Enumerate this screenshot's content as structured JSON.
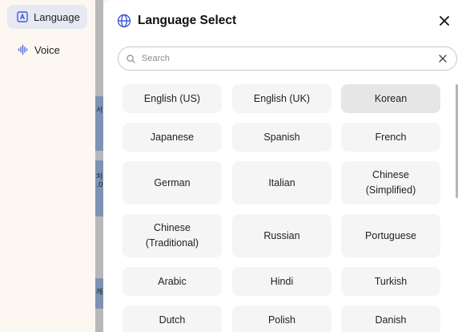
{
  "sidebar": {
    "items": [
      {
        "label": "Language",
        "icon": "language-icon"
      },
      {
        "label": "Voice",
        "icon": "voice-waveform-icon"
      }
    ]
  },
  "background_fragments": [
    "서",
    "처:",
    ".0",
    "캐-"
  ],
  "modal": {
    "title": "Language Select",
    "search_placeholder": "Search",
    "languages": [
      {
        "label": "English (US)",
        "selected": false
      },
      {
        "label": "English (UK)",
        "selected": false
      },
      {
        "label": "Korean",
        "selected": true
      },
      {
        "label": "Japanese",
        "selected": false
      },
      {
        "label": "Spanish",
        "selected": false
      },
      {
        "label": "French",
        "selected": false
      },
      {
        "label": "German",
        "selected": false
      },
      {
        "label": "Italian",
        "selected": false
      },
      {
        "label": "Chinese\n(Simplified)",
        "selected": false
      },
      {
        "label": "Chinese\n(Traditional)",
        "selected": false
      },
      {
        "label": "Russian",
        "selected": false
      },
      {
        "label": "Portuguese",
        "selected": false
      },
      {
        "label": "Arabic",
        "selected": false
      },
      {
        "label": "Hindi",
        "selected": false
      },
      {
        "label": "Turkish",
        "selected": false
      },
      {
        "label": "Dutch",
        "selected": false
      },
      {
        "label": "Polish",
        "selected": false
      },
      {
        "label": "Danish",
        "selected": false
      }
    ]
  },
  "colors": {
    "accent": "#3d5bd9",
    "selected_bg": "#e6e6e6",
    "button_bg": "#f5f5f5"
  }
}
